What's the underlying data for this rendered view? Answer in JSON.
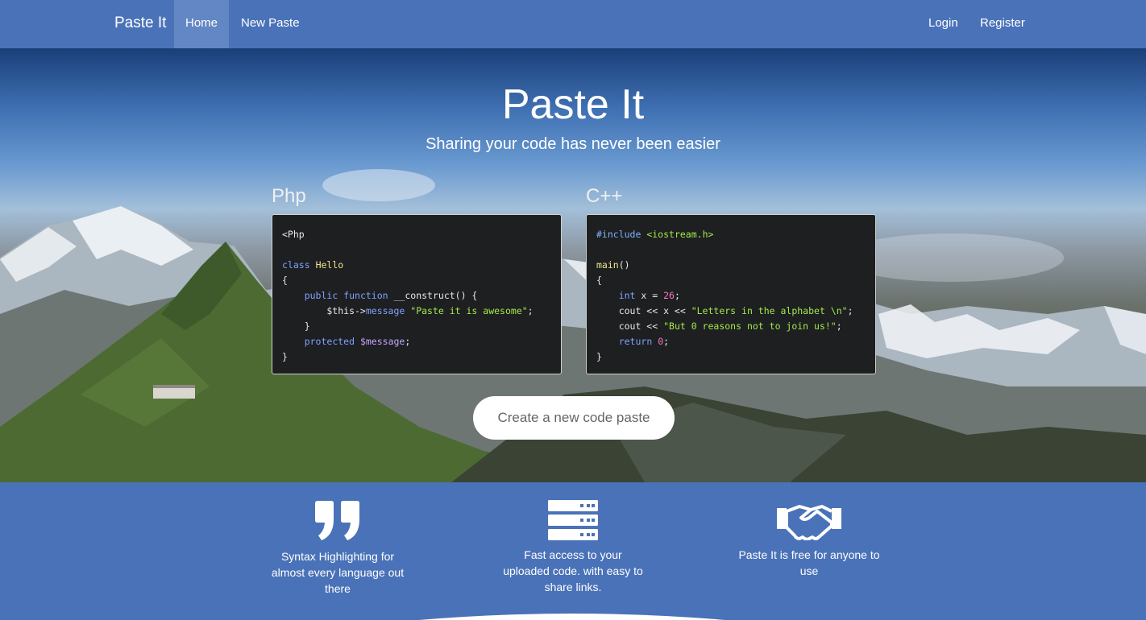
{
  "navbar": {
    "brand": "Paste It",
    "items": [
      {
        "label": "Home",
        "active": true
      },
      {
        "label": "New Paste",
        "active": false
      }
    ],
    "right_items": [
      {
        "label": "Login"
      },
      {
        "label": "Register"
      }
    ]
  },
  "hero": {
    "title": "Paste It",
    "subtitle": "Sharing your code has never been easier",
    "cta_label": "Create a new code paste"
  },
  "examples": {
    "php": {
      "language": "Php",
      "lines": [
        "<Php",
        "",
        "class Hello",
        "{",
        "    public function __construct() {",
        "        $this->message \"Paste it is awesome\";",
        "    }",
        "    protected $message;",
        "}"
      ]
    },
    "cpp": {
      "language": "C++",
      "lines": [
        "#include <iostream.h>",
        "",
        "main()",
        "{",
        "    int x = 26;",
        "    cout << x << \"Letters in the alphabet \\n\";",
        "    cout << \"But 0 reasons not to join us!\";",
        "    return 0;",
        "}"
      ]
    }
  },
  "features": [
    {
      "icon": "quote-icon",
      "text": "Syntax Highlighting for almost every language out there"
    },
    {
      "icon": "server-icon",
      "text": "Fast access to your uploaded code. with easy to share links."
    },
    {
      "icon": "handshake-icon",
      "text": "Paste It is free for anyone to use"
    }
  ],
  "colors": {
    "primary": "#4a72b8",
    "nav_active": "#6386c4",
    "code_bg": "#1d1f21",
    "code_keyword": "#81a2ff",
    "code_string": "#a5e84a",
    "code_number": "#ff75c6"
  }
}
